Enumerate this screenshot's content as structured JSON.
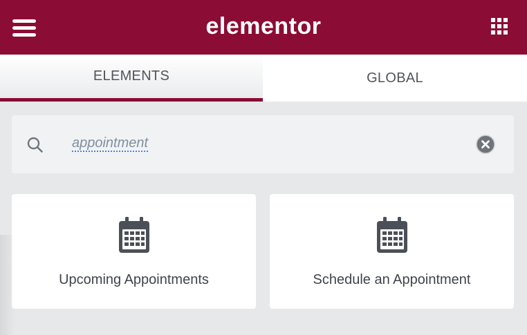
{
  "header": {
    "logo_text": "elementor",
    "background_color": "#8b0c35",
    "menu_icon": "hamburger-menu-icon",
    "apps_icon": "grid-apps-icon"
  },
  "tabs": [
    {
      "label": "ELEMENTS",
      "active": true
    },
    {
      "label": "GLOBAL",
      "active": false
    }
  ],
  "search": {
    "icon": "search-icon",
    "value": "appointment",
    "clear_icon": "clear-icon"
  },
  "widgets": [
    {
      "label": "Upcoming Appointments",
      "icon": "calendar-icon"
    },
    {
      "label": "Schedule an Appointment",
      "icon": "calendar-icon"
    }
  ],
  "colors": {
    "accent": "#8b0c35",
    "icon": "#4b5058",
    "panel_bg": "#e6e8ea"
  }
}
